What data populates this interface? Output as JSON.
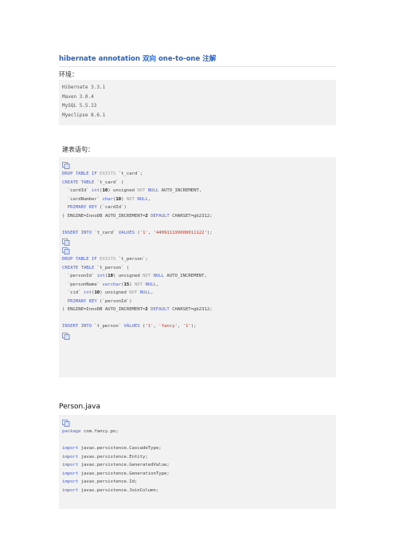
{
  "header": {
    "title_parts": [
      "hibernate annotation",
      "双向",
      "one-to-one",
      "注解"
    ]
  },
  "env": {
    "label": "环境：",
    "lines": [
      "Hibernate 3.3.1",
      "Maven 3.0.4",
      "MySQL 5.5.13",
      "Myeclipse 8.6.1"
    ]
  },
  "sql": {
    "label": "建表语句：",
    "lines": [
      "DROP TABLE IF EXISTS `t_card`;",
      "CREATE TABLE `t_card` (",
      "  `cardId` int(10) unsigned NOT NULL AUTO_INCREMENT,",
      "  `cardNumber` char(18) NOT NULL,",
      "  PRIMARY KEY (`cardId`)",
      ") ENGINE=InnoDB AUTO_INCREMENT=2 DEFAULT CHARSET=gb2312;",
      "",
      "INSERT INTO `t_card` VALUES ('1', '440911199008011122');",
      "DROP TABLE IF EXISTS `t_person`;",
      "CREATE TABLE `t_person` (",
      "  `personId` int(10) unsigned NOT NULL AUTO_INCREMENT,",
      "  `personName` varchar(15) NOT NULL,",
      "  `cid` int(10) unsigned NOT NULL,",
      "  PRIMARY KEY (`personId`)",
      ") ENGINE=InnoDB AUTO_INCREMENT=2 DEFAULT CHARSET=gb2312;",
      "",
      "INSERT INTO `t_person` VALUES ('1', 'fancy', '1');"
    ]
  },
  "java": {
    "section_title": "Person.java",
    "lines": [
      "package com.fancy.po;",
      "",
      "import javax.persistence.CascadeType;",
      "import javax.persistence.Entity;",
      "import javax.persistence.GeneratedValue;",
      "import javax.persistence.GenerationType;",
      "import javax.persistence.Id;",
      "import javax.persistence.JoinColumn;"
    ]
  },
  "colors": {
    "title": "#2a62c8",
    "keyword": "#4a5fd0",
    "string": "#c0392b",
    "code_bg": "#f2f2f2"
  },
  "icons": [
    "copy-code-icon"
  ]
}
